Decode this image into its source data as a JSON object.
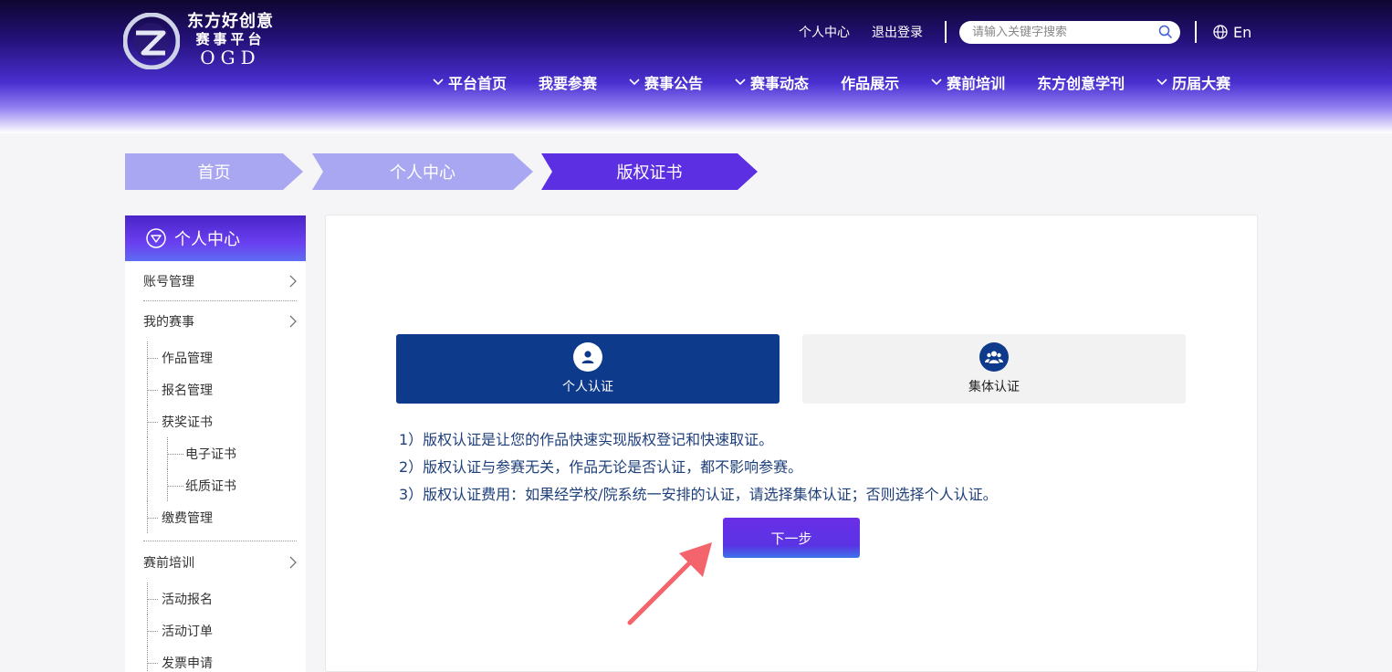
{
  "header": {
    "logo": {
      "line1": "东方好创意",
      "line2": "赛事平台",
      "line3": "OGD"
    },
    "links": [
      "个人中心",
      "退出登录"
    ],
    "search": {
      "placeholder": "请输入关键字搜索",
      "value": ""
    },
    "lang": "En",
    "nav": [
      {
        "label": "平台首页",
        "dropdown": true
      },
      {
        "label": "我要参赛",
        "dropdown": false
      },
      {
        "label": "赛事公告",
        "dropdown": true
      },
      {
        "label": "赛事动态",
        "dropdown": true
      },
      {
        "label": "作品展示",
        "dropdown": false
      },
      {
        "label": "赛前培训",
        "dropdown": true
      },
      {
        "label": "东方创意学刊",
        "dropdown": false
      },
      {
        "label": "历届大赛",
        "dropdown": true
      }
    ]
  },
  "breadcrumb": [
    "首页",
    "个人中心",
    "版权证书"
  ],
  "sidebar": {
    "title": "个人中心",
    "account": "账号管理",
    "my_events": "我的赛事",
    "my_events_items": [
      "作品管理",
      "报名管理",
      "获奖证书"
    ],
    "certificate_items": [
      "电子证书",
      "纸质证书"
    ],
    "fee": "缴费管理",
    "training": "赛前培训",
    "training_items": [
      "活动报名",
      "活动订单",
      "发票申请"
    ]
  },
  "main": {
    "tabs": [
      {
        "label": "个人认证",
        "icon": "person-icon",
        "active": true
      },
      {
        "label": "集体认证",
        "icon": "group-icon",
        "active": false
      }
    ],
    "notes": [
      "1）版权认证是让您的作品快速实现版权登记和快速取证。",
      "2）版权认证与参赛无关，作品无论是否认证，都不影响参赛。",
      "3）版权认证费用：如果经学校/院系统一安排的认证，请选择集体认证；否则选择个人认证。"
    ],
    "next_label": "下一步"
  },
  "colors": {
    "accent": "#5c2fe3",
    "tab_active": "#0e3a8c",
    "crumb_inactive": "#a9a7f2",
    "annotation_arrow": "#f4646c"
  }
}
